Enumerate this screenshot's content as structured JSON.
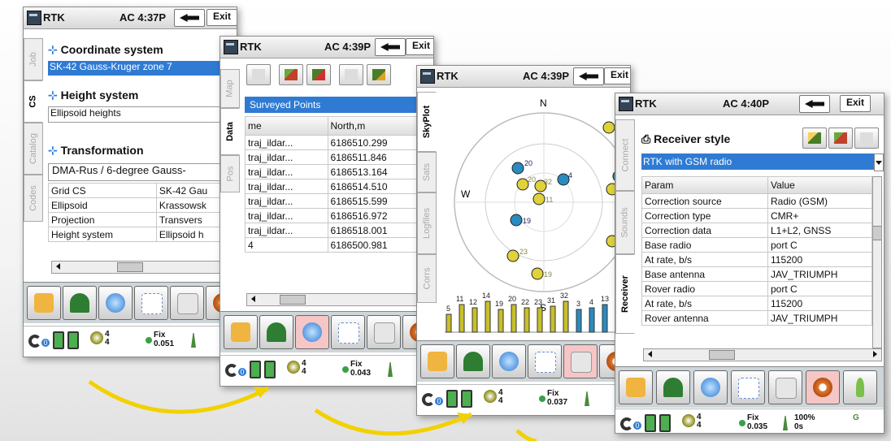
{
  "windows": {
    "w1": {
      "app": "RTK",
      "time": "AC 4:37P",
      "exit": "Exit",
      "tabs": [
        "Job",
        "CS",
        "Catalog",
        "Codes"
      ],
      "coord_title": "Coordinate system",
      "coord_value": "SK-42 Gauss-Kruger zone 7",
      "height_title": "Height system",
      "height_value": "Ellipsoid heights",
      "transform_title": "Transformation",
      "transform_value": "DMA-Rus / 6-degree Gauss-",
      "props": [
        {
          "k": "Grid CS",
          "v": "SK-42 Gau"
        },
        {
          "k": "Ellipsoid",
          "v": "Krassowsk"
        },
        {
          "k": "Projection",
          "v": "Transvers"
        },
        {
          "k": "Height system",
          "v": "Ellipsoid h"
        }
      ],
      "status": {
        "sats": "4",
        "sats_sub": "4",
        "fix": "Fix",
        "fix_val": "0.051"
      }
    },
    "w2": {
      "app": "RTK",
      "time": "AC 4:39P",
      "exit": "Exit",
      "tabs": [
        "Map",
        "Data",
        "Pos"
      ],
      "list_title": "Surveyed Points",
      "col_name": "me",
      "col_north": "North,m",
      "rows": [
        {
          "n": "traj_ildar...",
          "v": "6186510.299"
        },
        {
          "n": "traj_ildar...",
          "v": "6186511.846"
        },
        {
          "n": "traj_ildar...",
          "v": "6186513.164"
        },
        {
          "n": "traj_ildar...",
          "v": "6186514.510"
        },
        {
          "n": "traj_ildar...",
          "v": "6186515.599"
        },
        {
          "n": "traj_ildar...",
          "v": "6186516.972"
        },
        {
          "n": "traj_ildar...",
          "v": "6186518.001"
        },
        {
          "n": "4",
          "v": "6186500.981"
        }
      ],
      "status": {
        "sats": "4",
        "sats_sub": "4",
        "fix": "Fix",
        "fix_val": "0.043"
      }
    },
    "w3": {
      "app": "RTK",
      "time": "AC 4:39P",
      "exit": "Exit",
      "tabs": [
        "SkyPlot",
        "Sats",
        "Logfiles",
        "Corrs"
      ],
      "compass": {
        "n": "N",
        "s": "S",
        "w": "W"
      },
      "sat_labels": [
        "20",
        "4",
        "32",
        "11",
        "19",
        "23",
        "19",
        "20"
      ],
      "bar_labels": [
        "5",
        "11",
        "12",
        "14",
        "19",
        "20",
        "22",
        "23",
        "31",
        "32",
        "3",
        "4",
        "13"
      ],
      "status": {
        "sats": "4",
        "sats_sub": "4",
        "fix": "Fix",
        "fix_val": "0.037"
      }
    },
    "w4": {
      "app": "RTK",
      "time": "AC 4:40P",
      "exit": "Exit",
      "tabs": [
        "Connect",
        "Sounds",
        "Receiver"
      ],
      "style_title": "Receiver style",
      "style_value": "RTK with GSM radio",
      "col_param": "Param",
      "col_value": "Value",
      "rows": [
        {
          "k": "Correction source",
          "v": "Radio (GSM)"
        },
        {
          "k": "Correction type",
          "v": "CMR+"
        },
        {
          "k": "Correction data",
          "v": "L1+L2, GNSS"
        },
        {
          "k": "Base radio",
          "v": "port C"
        },
        {
          "k": "At rate, b/s",
          "v": "115200"
        },
        {
          "k": "Base antenna",
          "v": "JAV_TRIUMPH"
        },
        {
          "k": "Rover radio",
          "v": "port C"
        },
        {
          "k": "At rate, b/s",
          "v": "115200"
        },
        {
          "k": "Rover antenna",
          "v": "JAV_TRIUMPH"
        }
      ],
      "status": {
        "sats": "4",
        "sats_sub": "4",
        "fix": "Fix",
        "fix_val": "0.035",
        "radio": "100%",
        "radio_sub": "0s",
        "g": "G"
      }
    }
  },
  "accent": "#2f7bd3",
  "arrow_color": "#f2d100",
  "toolbar_icons": [
    "folder-icon",
    "survey-icon",
    "globe-icon",
    "cogo-icon",
    "document-icon",
    "gear-icon",
    "info-icon"
  ]
}
